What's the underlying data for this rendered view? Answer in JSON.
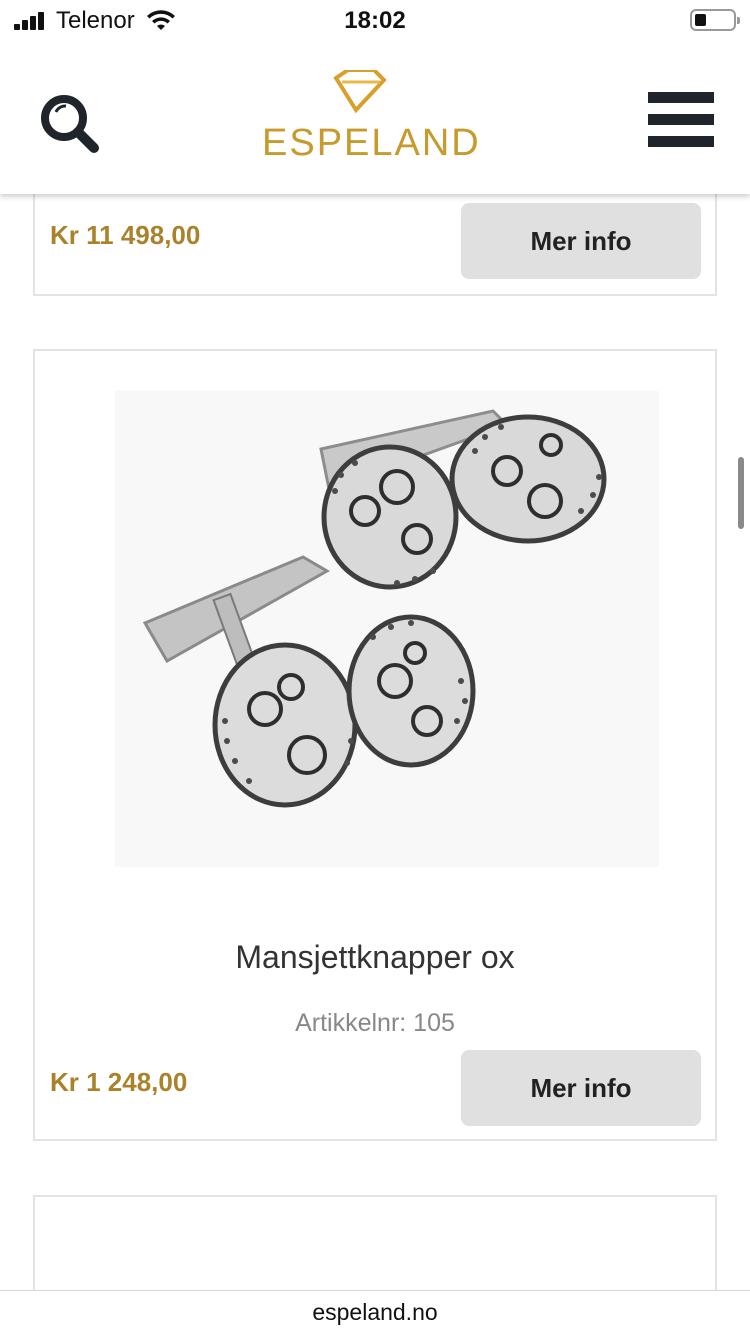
{
  "status_bar": {
    "carrier": "Telenor",
    "time": "18:02"
  },
  "header": {
    "logo_text": "ESPELAND",
    "search_icon": "search-icon",
    "menu_icon": "hamburger-menu-icon",
    "brand_color": "#c79a2c"
  },
  "products": [
    {
      "price": "Kr 11 498,00",
      "button_label": "Mer info"
    },
    {
      "title": "Mansjettknapper ox",
      "article_no": "Artikkelnr: 105",
      "price": "Kr 1 248,00",
      "button_label": "Mer info",
      "image_icon": "cufflinks-image"
    }
  ],
  "colors": {
    "price": "#a9822b",
    "button_bg": "#e0e0e0",
    "card_border": "#e3e3e3"
  },
  "url_bar": {
    "domain": "espeland.no"
  }
}
